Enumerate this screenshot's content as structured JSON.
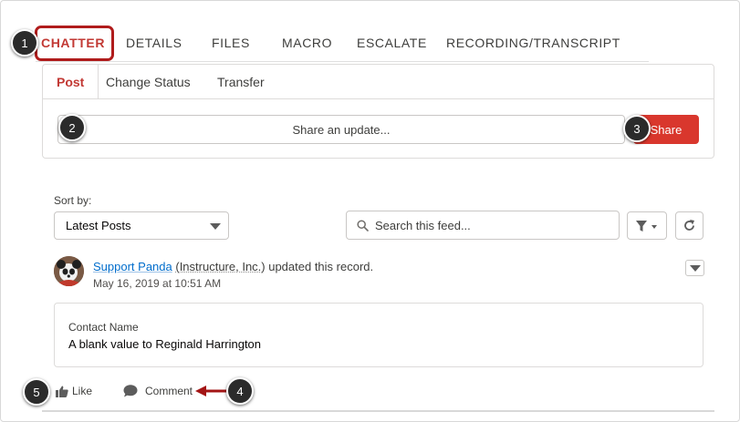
{
  "tabs": [
    {
      "label": "CHATTER",
      "active": true
    },
    {
      "label": "DETAILS"
    },
    {
      "label": "FILES"
    },
    {
      "label": "MACRO"
    },
    {
      "label": "ESCALATE"
    },
    {
      "label": "RECORDING/TRANSCRIPT"
    }
  ],
  "publisher": {
    "subtabs": [
      {
        "label": "Post",
        "active": true
      },
      {
        "label": "Change Status"
      },
      {
        "label": "Transfer"
      }
    ],
    "share_placeholder": "Share an update...",
    "share_button": "Share"
  },
  "feed_controls": {
    "sort_label": "Sort by:",
    "sort_value": "Latest Posts",
    "search_placeholder": "Search this feed..."
  },
  "feed_item": {
    "author": "Support Panda",
    "company": "(Instructure, Inc.)",
    "action_text": " updated this record.",
    "timestamp": "May 16, 2019 at 10:51 AM",
    "field_label": "Contact Name",
    "field_change": "A blank value to Reginald Harrington",
    "like_label": "Like",
    "comment_label": "Comment"
  },
  "callouts": [
    "1",
    "2",
    "3",
    "4",
    "5"
  ],
  "colors": {
    "accent_red": "#c23934",
    "share_button": "#d9372d",
    "link_blue": "#006dcc",
    "callout_dark": "#2b2b2b",
    "arrow_red": "#a31515"
  },
  "icons": {
    "search": "search-icon",
    "filter": "filter-icon",
    "refresh": "refresh-icon",
    "like": "thumbs-up-icon",
    "comment": "comment-bubble-icon"
  }
}
